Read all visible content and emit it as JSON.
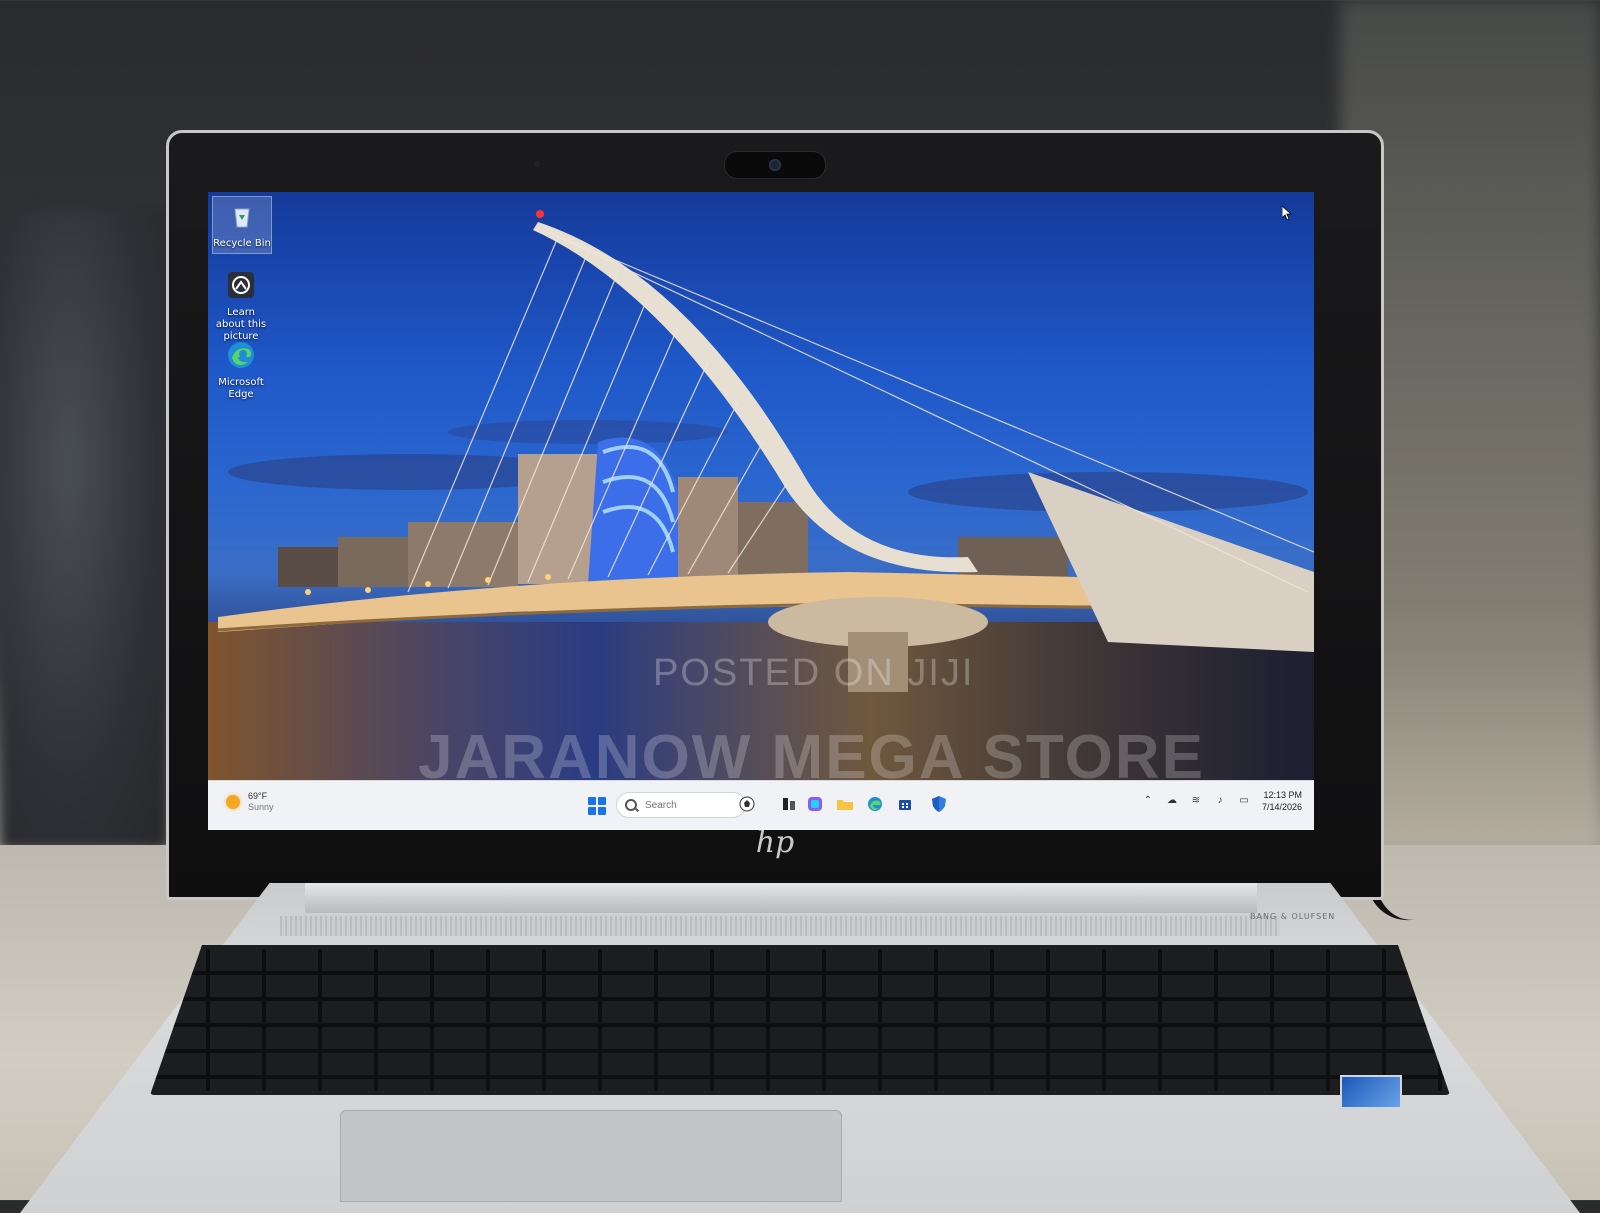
{
  "desktop": {
    "icons": [
      {
        "label": "Recycle Bin"
      },
      {
        "label": "Learn about this picture"
      },
      {
        "label": "Microsoft Edge"
      }
    ]
  },
  "watermark": {
    "line1": "POSTED ON JIJI",
    "line2": "JARANOW MEGA STORE"
  },
  "taskbar": {
    "weather_temp": "69°F",
    "weather_condition": "Sunny",
    "search_placeholder": "Search",
    "clock_time": "12:13 PM",
    "clock_date": "7/14/2026"
  },
  "hardware": {
    "brand_logo": "hp",
    "deck_label": "BANG & OLUFSEN"
  },
  "colors": {
    "accent": "#1a73e8",
    "taskbar_bg": "#f1f2f6",
    "sky_top": "#143a9a"
  }
}
